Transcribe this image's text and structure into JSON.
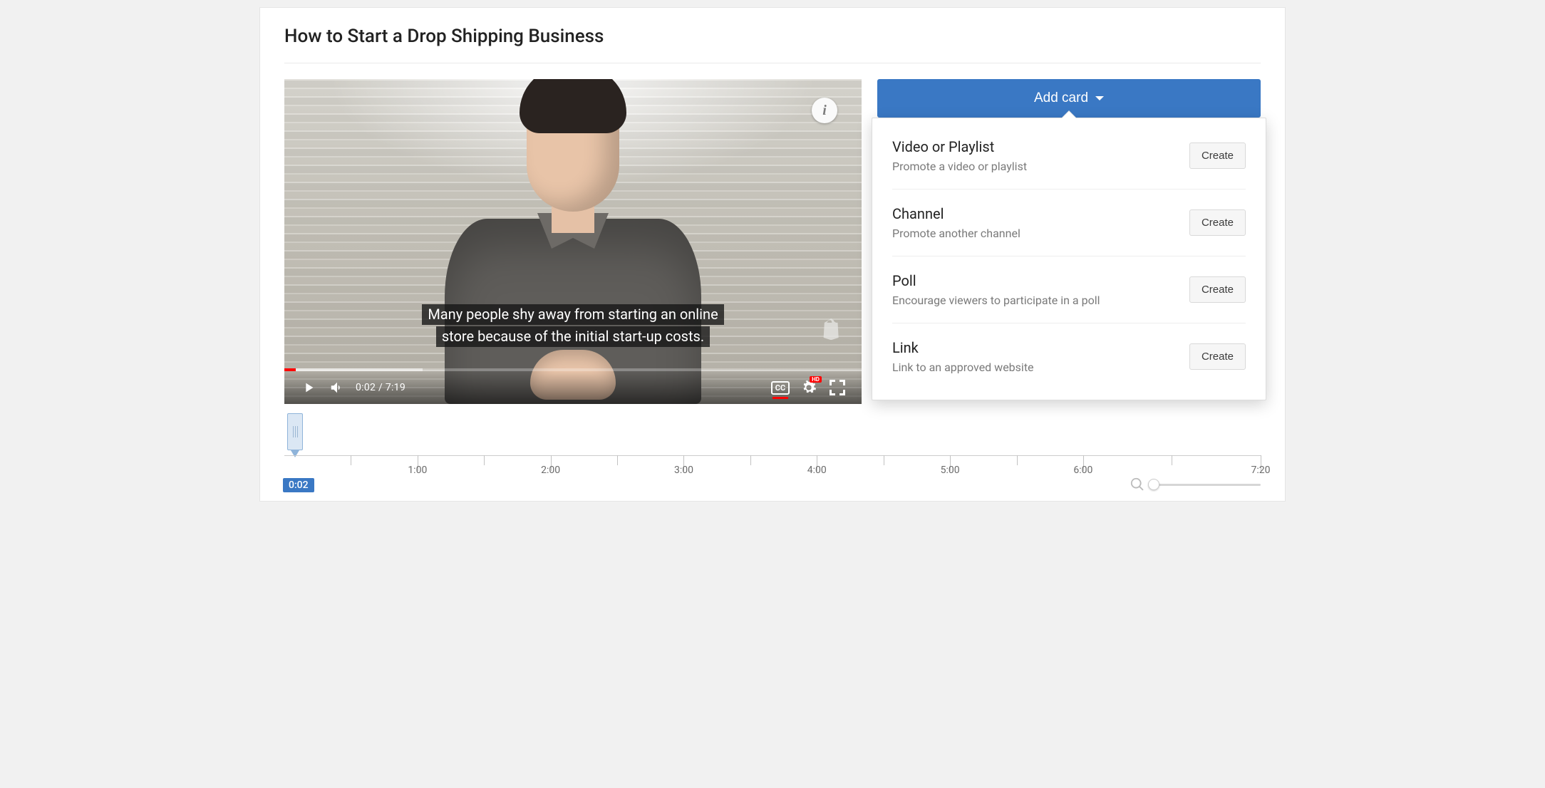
{
  "title": "How to Start a Drop Shipping Business",
  "player": {
    "caption_line1": "Many people shy away from starting an online",
    "caption_line2": "store because of the initial start-up costs.",
    "time_current": "0:02",
    "time_sep": " / ",
    "duration": "7:19",
    "cc_label": "CC",
    "hd_label": "HD",
    "info_char": "i"
  },
  "addCard": {
    "label": "Add card"
  },
  "cardTypes": [
    {
      "title": "Video or Playlist",
      "desc": "Promote a video or playlist",
      "button": "Create"
    },
    {
      "title": "Channel",
      "desc": "Promote another channel",
      "button": "Create"
    },
    {
      "title": "Poll",
      "desc": "Encourage viewers to participate in a poll",
      "button": "Create"
    },
    {
      "title": "Link",
      "desc": "Link to an approved website",
      "button": "Create"
    }
  ],
  "timeline": {
    "current_label": "0:02",
    "ticks": [
      "1:00",
      "2:00",
      "3:00",
      "4:00",
      "5:00",
      "6:00",
      "7:20"
    ],
    "duration_seconds": 440
  }
}
